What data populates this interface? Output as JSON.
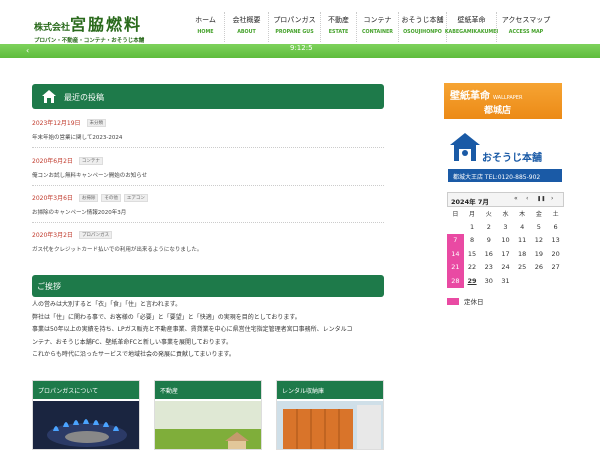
{
  "logo": {
    "kaisha": "株式会社",
    "name": "宮脇燃料",
    "tagline": "プロパン・不動産・コンテナ・おそうじ本舗"
  },
  "nav": [
    {
      "jp": "ホーム",
      "en": "HOME"
    },
    {
      "jp": "会社概要",
      "en": "ABOUT"
    },
    {
      "jp": "プロパンガス",
      "en": "PROPANE GUS"
    },
    {
      "jp": "不動産",
      "en": "ESTATE"
    },
    {
      "jp": "コンテナ",
      "en": "CONTAINER"
    },
    {
      "jp": "おそうじ本舗",
      "en": "OSOUJIHONPO"
    },
    {
      "jp": "壁紙革命",
      "en": "KABEGAMIKAKUMEI"
    },
    {
      "jp": "アクセスマップ",
      "en": "ACCESS MAP"
    }
  ],
  "greenbar": {
    "arrow": "‹",
    "clock": "9:12:5"
  },
  "posts": {
    "title": "最近の投稿",
    "items": [
      {
        "date": "2023年12月19日",
        "tags": [
          "未分類"
        ],
        "title": "年末年始の営業に関して2023-2024"
      },
      {
        "date": "2020年6月2日",
        "tags": [
          "コンテナ"
        ],
        "title": "俺コンお試し無料キャンペーン開始のお知らせ"
      },
      {
        "date": "2020年3月6日",
        "tags": [
          "お掃除",
          "その他",
          "エアコン"
        ],
        "title": "お掃除のキャンペーン情報2020年3月"
      },
      {
        "date": "2020年3月2日",
        "tags": [
          "プロパンガス"
        ],
        "title": "ガス代をクレジットカード払いでの利用が出来るようになりました。"
      }
    ]
  },
  "greeting": {
    "title": "ご挨拶",
    "lines": [
      "人の営みは大別すると「衣」「食」「住」と言われます。",
      "弊社は「住」に関わる事で、お客様の「必要」と「要望」と「快適」の実現を目的としております。",
      "事業は50年以上の実績を持ち、LPガス販売と不動産事業、賃貸業を中心に県営住宅指定管理者宮口事務所、レンタルコ",
      "ンテナ、おそうじ本舗FC、壁紙革命FCと新しい事業を展開しております。",
      "これからも時代に沿ったサービスで地域社会の発展に貢献してまいります。"
    ]
  },
  "cards": [
    {
      "label": "プロパンガスについて"
    },
    {
      "label": "不動産"
    },
    {
      "label": "レンタル収納庫"
    }
  ],
  "sidebar": {
    "ad1": {
      "line1": "壁紙革命",
      "small": "WALLPAPER",
      "line2": "都城店"
    },
    "ad2": {
      "brand": "おそうじ本舗",
      "phone": "都城大王店 TEL:0120-885-902"
    }
  },
  "calendar": {
    "month": "2024年 7月",
    "prev": "«",
    "mid": "‹",
    "pause": "❚❚",
    "next": "›",
    "dow": [
      "日",
      "月",
      "火",
      "水",
      "木",
      "金",
      "土"
    ],
    "weeks": [
      [
        "",
        "1",
        "2",
        "3",
        "4",
        "5",
        "6"
      ],
      [
        "7",
        "8",
        "9",
        "10",
        "11",
        "12",
        "13"
      ],
      [
        "14",
        "15",
        "16",
        "17",
        "18",
        "19",
        "20"
      ],
      [
        "21",
        "22",
        "23",
        "24",
        "25",
        "26",
        "27"
      ],
      [
        "28",
        "29",
        "30",
        "31",
        "",
        "",
        ""
      ]
    ],
    "holidays": [
      "7",
      "14",
      "21",
      "28"
    ],
    "today": "29",
    "legend": "定休日",
    "colors": {
      "holiday": "#e94aa3",
      "saturday": "#1a5aa6"
    }
  },
  "colors": {
    "brand_green": "#1e7a4a",
    "nav_green": "#44a12a",
    "date_red": "#c0392b"
  }
}
